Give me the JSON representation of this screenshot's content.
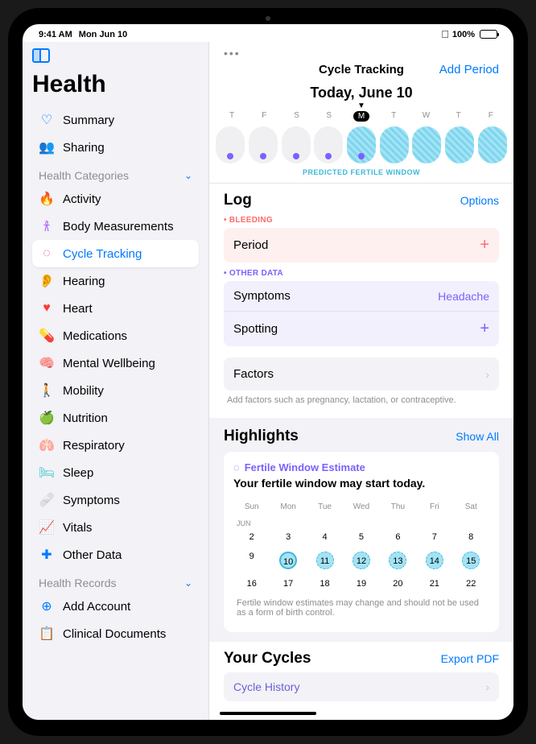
{
  "status": {
    "time": "9:41 AM",
    "date": "Mon Jun 10",
    "battery": "100%"
  },
  "app_title": "Health",
  "top_nav": [
    {
      "label": "Summary"
    },
    {
      "label": "Sharing"
    }
  ],
  "section_categories": "Health Categories",
  "categories": [
    {
      "label": "Activity"
    },
    {
      "label": "Body Measurements"
    },
    {
      "label": "Cycle Tracking",
      "selected": true
    },
    {
      "label": "Hearing"
    },
    {
      "label": "Heart"
    },
    {
      "label": "Medications"
    },
    {
      "label": "Mental Wellbeing"
    },
    {
      "label": "Mobility"
    },
    {
      "label": "Nutrition"
    },
    {
      "label": "Respiratory"
    },
    {
      "label": "Sleep"
    },
    {
      "label": "Symptoms"
    },
    {
      "label": "Vitals"
    },
    {
      "label": "Other Data"
    }
  ],
  "section_records": "Health Records",
  "records": [
    {
      "label": "Add Account"
    },
    {
      "label": "Clinical Documents"
    }
  ],
  "header": {
    "title": "Cycle Tracking",
    "action": "Add Period"
  },
  "today": "Today, June 10",
  "week": {
    "days": [
      "T",
      "F",
      "S",
      "S",
      "M",
      "T",
      "W",
      "T",
      "F"
    ]
  },
  "fertile_label": "PREDICTED FERTILE WINDOW",
  "log": {
    "title": "Log",
    "options": "Options",
    "bleeding_hdr": "• BLEEDING",
    "period": "Period",
    "other_hdr": "• OTHER DATA",
    "symptoms": "Symptoms",
    "symptoms_val": "Headache",
    "spotting": "Spotting",
    "factors": "Factors",
    "factors_hint": "Add factors such as pregnancy, lactation, or contraceptive."
  },
  "highlights": {
    "title": "Highlights",
    "show_all": "Show All",
    "card_hdr": "Fertile Window Estimate",
    "card_title": "Your fertile window may start today.",
    "wdays": [
      "Sun",
      "Mon",
      "Tue",
      "Wed",
      "Thu",
      "Fri",
      "Sat"
    ],
    "month": "JUN",
    "rows": [
      [
        "2",
        "3",
        "4",
        "5",
        "6",
        "7",
        "8"
      ],
      [
        "9",
        "10",
        "11",
        "12",
        "13",
        "14",
        "15"
      ],
      [
        "16",
        "17",
        "18",
        "19",
        "20",
        "21",
        "22"
      ]
    ],
    "disclaimer": "Fertile window estimates may change and should not be used as a form of birth control."
  },
  "your_cycles": {
    "title": "Your Cycles",
    "export": "Export PDF",
    "history": "Cycle History"
  }
}
